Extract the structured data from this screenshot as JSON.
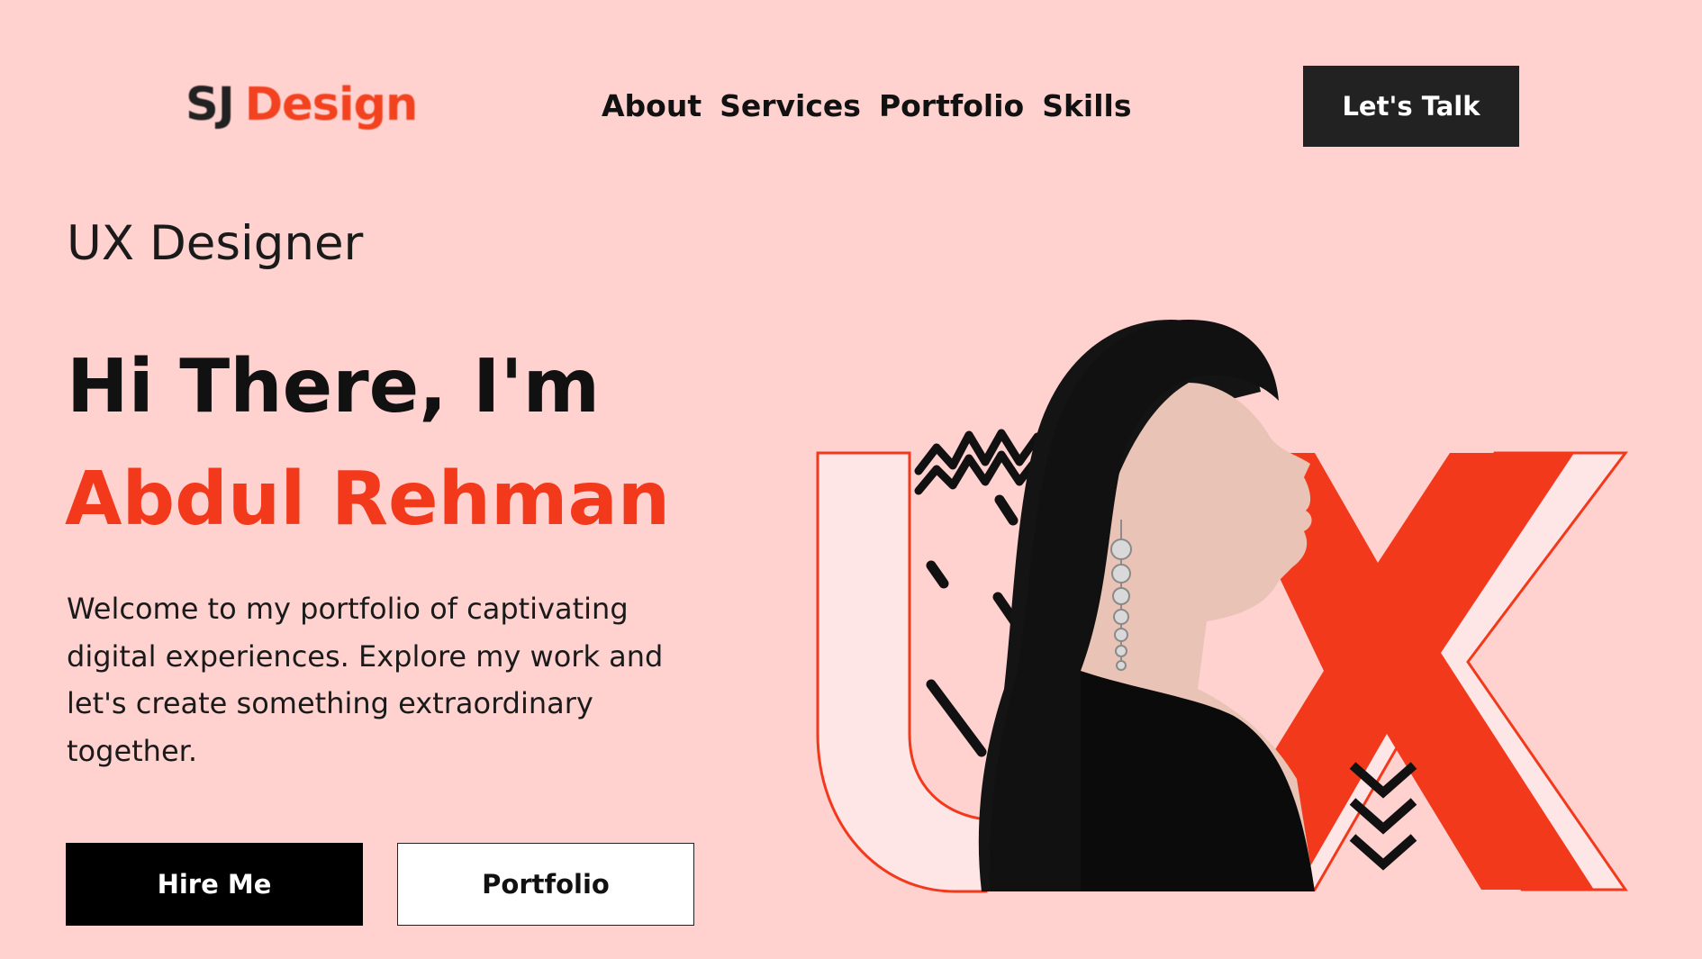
{
  "nav": {
    "logo_mark": "SJ",
    "logo_text": "Design",
    "links": [
      {
        "label": "About"
      },
      {
        "label": "Services"
      },
      {
        "label": "Portfolio"
      },
      {
        "label": "Skills"
      }
    ],
    "cta_label": "Let's Talk"
  },
  "hero": {
    "role": "UX Designer",
    "greeting": "Hi There, I'm",
    "name": "Abdul Rehman",
    "intro": "Welcome to my portfolio of captivating digital experiences. Explore my work and let's create something extraordinary together.",
    "hire_label": "Hire Me",
    "portfolio_label": "Portfolio"
  },
  "art": {
    "subject": "portrait-of-woman-profile",
    "letters": "UX"
  },
  "colors": {
    "background": "#ffd1cf",
    "accent": "#f2391c",
    "dark": "#111111",
    "light_shape": "#ffe6e6"
  }
}
